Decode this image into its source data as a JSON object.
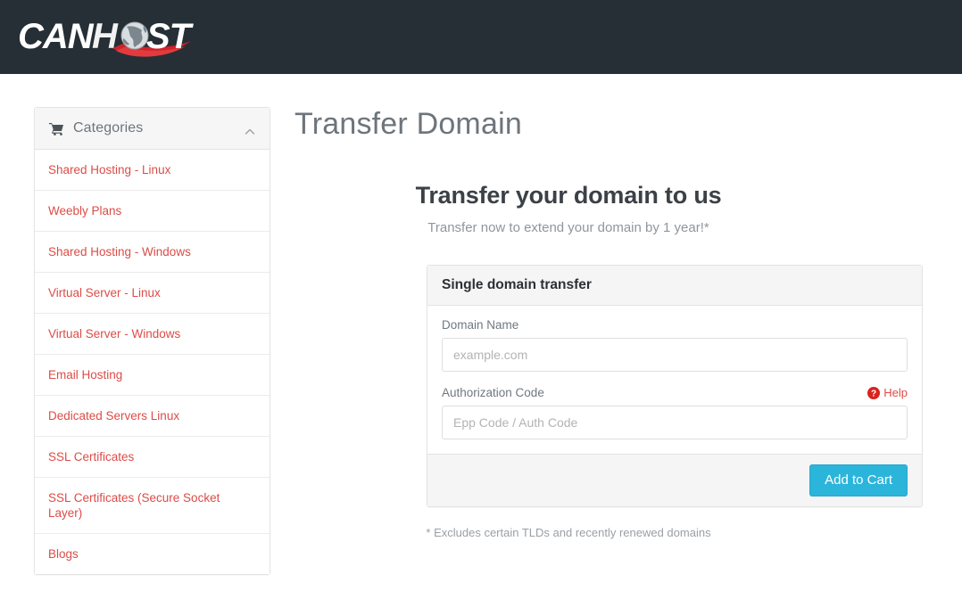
{
  "brand": {
    "name": "CANHOST",
    "name_part1": "CAN",
    "name_part2": "H",
    "name_part3": "ST",
    "globe_icon": "globe-icon",
    "header_bg": "#262f36",
    "accent_red": "#dc4c47",
    "accent_cyan": "#2cb5db"
  },
  "sidebar": {
    "header": {
      "title": "Categories",
      "cart_icon": "shopping-cart-icon",
      "collapse_icon": "chevron-up-icon"
    },
    "items": [
      {
        "label": "Shared Hosting - Linux"
      },
      {
        "label": "Weebly Plans"
      },
      {
        "label": "Shared Hosting - Windows"
      },
      {
        "label": "Virtual Server - Linux"
      },
      {
        "label": "Virtual Server - Windows"
      },
      {
        "label": "Email Hosting"
      },
      {
        "label": "Dedicated Servers Linux"
      },
      {
        "label": "SSL Certificates"
      },
      {
        "label": "SSL Certificates (Secure Socket Layer)"
      },
      {
        "label": "Blogs"
      }
    ]
  },
  "main": {
    "page_title": "Transfer Domain",
    "heading": "Transfer your domain to us",
    "subheading": "Transfer now to extend your domain by 1 year!*",
    "footnote": "* Excludes certain TLDs and recently renewed domains"
  },
  "panel": {
    "title": "Single domain transfer",
    "fields": [
      {
        "label": "Domain Name",
        "placeholder": "example.com",
        "value": ""
      },
      {
        "label": "Authorization Code",
        "placeholder": "Epp Code / Auth Code",
        "value": ""
      }
    ],
    "help": {
      "label": "Help",
      "icon": "question-circle-icon"
    },
    "submit_label": "Add to Cart"
  }
}
